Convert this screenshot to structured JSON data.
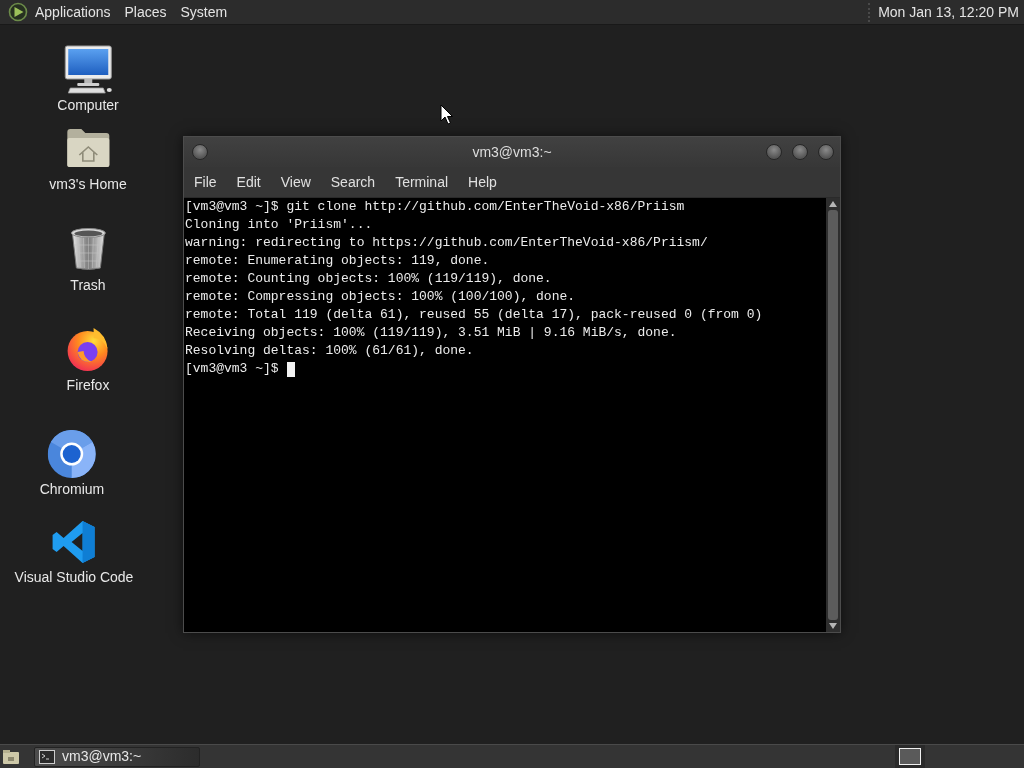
{
  "top_panel": {
    "menus": [
      "Applications",
      "Places",
      "System"
    ],
    "clock": "Mon Jan 13, 12:20 PM"
  },
  "desktop_icons": [
    {
      "label": "Computer",
      "kind": "computer"
    },
    {
      "label": "vm3's Home",
      "kind": "home"
    },
    {
      "label": "Trash",
      "kind": "trash"
    },
    {
      "label": "Firefox",
      "kind": "firefox"
    },
    {
      "label": "Chromium",
      "kind": "chromium"
    },
    {
      "label": "Visual Studio Code",
      "kind": "vscode"
    }
  ],
  "terminal_window": {
    "title": "vm3@vm3:~",
    "menu": [
      "File",
      "Edit",
      "View",
      "Search",
      "Terminal",
      "Help"
    ],
    "lines": [
      "[vm3@vm3 ~]$ git clone http://github.com/EnterTheVoid-x86/Priism",
      "Cloning into 'Priism'...",
      "warning: redirecting to https://github.com/EnterTheVoid-x86/Priism/",
      "remote: Enumerating objects: 119, done.",
      "remote: Counting objects: 100% (119/119), done.",
      "remote: Compressing objects: 100% (100/100), done.",
      "remote: Total 119 (delta 61), reused 55 (delta 17), pack-reused 0 (from 0)",
      "Receiving objects: 100% (119/119), 3.51 MiB | 9.16 MiB/s, done.",
      "Resolving deltas: 100% (61/61), done.",
      "[vm3@vm3 ~]$"
    ]
  },
  "bottom_panel": {
    "tasks": [
      {
        "label": "vm3@vm3:~"
      }
    ],
    "workspaces": [
      {
        "selected": true
      }
    ]
  }
}
